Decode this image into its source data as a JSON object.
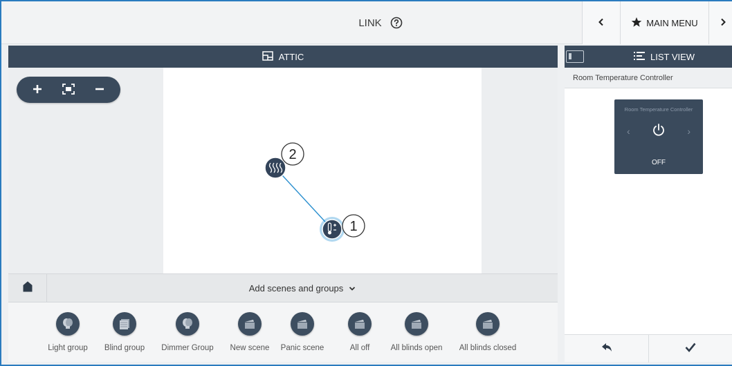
{
  "header": {
    "title": "LINK",
    "help_icon": "question-circle-icon",
    "main_menu_label": "MAIN MENU",
    "prev_icon": "chevron-left-icon",
    "next_icon": "chevron-right-icon",
    "star_icon": "star-icon"
  },
  "floor_plan": {
    "room_name": "ATTIC",
    "room_icon": "floor-plan-icon",
    "zoom_controls": [
      "zoom-in-icon",
      "fit-screen-icon",
      "zoom-out-icon"
    ],
    "nodes": [
      {
        "number": "1",
        "icon": "thermostat-icon",
        "role": "sensor"
      },
      {
        "number": "2",
        "icon": "heating-icon",
        "role": "actuator"
      }
    ]
  },
  "scene_bar": {
    "label": "Add scenes and groups",
    "home_icon": "house-icon",
    "chevron_icon": "chevron-down-icon"
  },
  "tray": {
    "items": [
      {
        "label": "Light group",
        "icon": "bulb-icon"
      },
      {
        "label": "Blind group",
        "icon": "blind-icon"
      },
      {
        "label": "Dimmer Group",
        "icon": "bulb-icon"
      },
      {
        "label": "New scene",
        "icon": "clapper-icon"
      },
      {
        "label": "Panic scene",
        "icon": "clapper-icon"
      },
      {
        "label": "All off",
        "icon": "clapper-icon"
      },
      {
        "label": "All blinds open",
        "icon": "clapper-icon"
      },
      {
        "label": "All blinds closed",
        "icon": "clapper-icon"
      }
    ]
  },
  "list_view": {
    "title": "LIST VIEW",
    "device_name": "Room Temperature Controller",
    "tile": {
      "name": "Room Temperature Controller",
      "state": "OFF",
      "left_arrow": "‹",
      "right_arrow": "›"
    },
    "back_icon": "reply-icon",
    "confirm_icon": "checkmark-icon"
  },
  "colors": {
    "accent_dark": "#3a4a5c",
    "link_line": "#2a8fcf",
    "frame_border": "#2a7bbf"
  }
}
